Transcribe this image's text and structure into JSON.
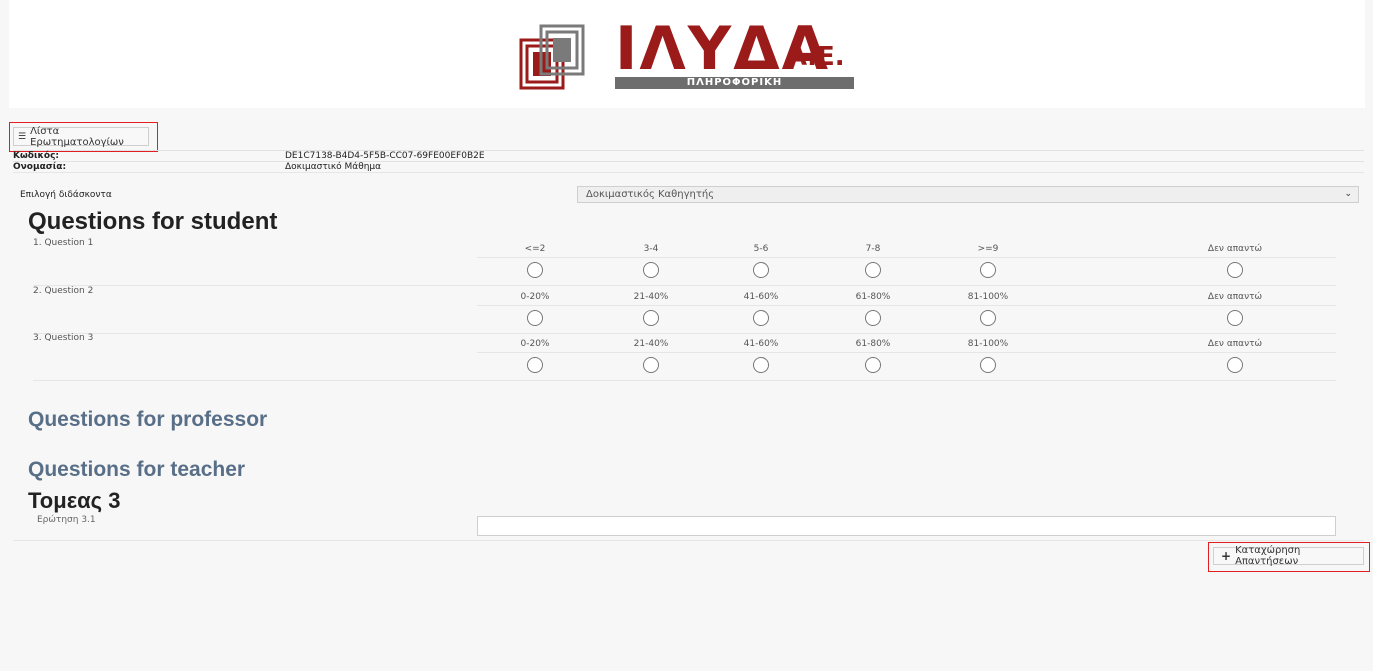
{
  "logo": {
    "name": "ΙΛΥΔΑ",
    "suffix": "Α.Ε.",
    "tagline": "ΠΛΗΡΟΦΟΡΙΚΗ",
    "brand_color": "#9b1a1a"
  },
  "toolbar": {
    "list_button_label": "Λίστα Ερωτηματολογίων",
    "list_button_icon": "list-icon"
  },
  "info": {
    "code_label": "Κωδικός:",
    "code_value": "DE1C7138-B4D4-5F5B-CC07-69FE00EF0B2E",
    "name_label": "Ονομασία:",
    "name_value": "Δοκιμαστικό Μάθημα"
  },
  "teacher_select": {
    "label": "Επιλογή διδάσκοντα",
    "selected": "Δοκιμαστικός Καθηγητής"
  },
  "sections": {
    "student": "Questions for student",
    "professor": "Questions for professor",
    "teacher": "Questions for teacher",
    "sector": "Τομεας 3"
  },
  "questions": [
    {
      "label": "1. Question 1",
      "options": [
        "<=2",
        "3-4",
        "5-6",
        "7-8",
        ">=9",
        "Δεν απαντώ"
      ]
    },
    {
      "label": "2. Question 2",
      "options": [
        "0-20%",
        "21-40%",
        "41-60%",
        "61-80%",
        "81-100%",
        "Δεν απαντώ"
      ]
    },
    {
      "label": "3. Question 3",
      "options": [
        "0-20%",
        "21-40%",
        "41-60%",
        "61-80%",
        "81-100%",
        "Δεν απαντώ"
      ]
    }
  ],
  "sector_question": {
    "label": "Ερώτηση 3.1",
    "value": ""
  },
  "submit": {
    "label": "Καταχώρηση Απαντήσεων"
  }
}
